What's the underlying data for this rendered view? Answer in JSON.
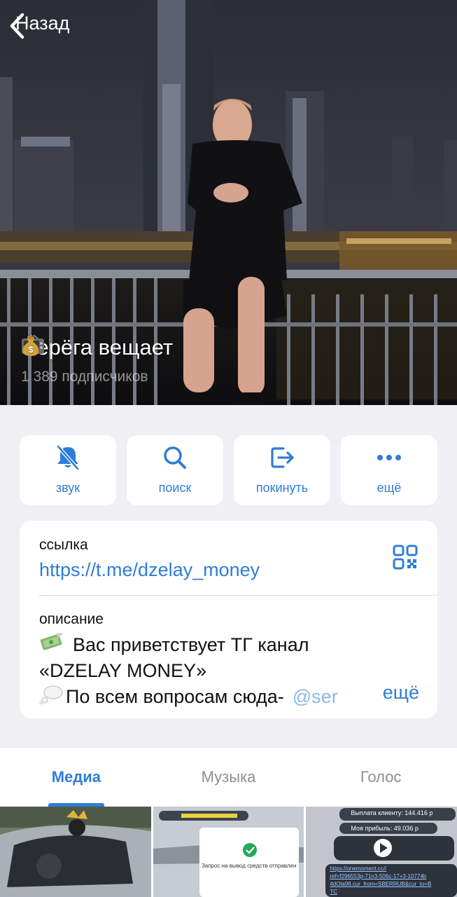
{
  "nav": {
    "back_label": "Назад"
  },
  "channel": {
    "title": "Серёга вещает",
    "subscribers": "1 389 подписчиков",
    "title_icons": [
      "tv-icon",
      "money-bag-icon"
    ]
  },
  "actions": [
    {
      "label": "звук",
      "icon": "bell-off-icon"
    },
    {
      "label": "поиск",
      "icon": "search-icon"
    },
    {
      "label": "покинуть",
      "icon": "leave-icon"
    },
    {
      "label": "ещё",
      "icon": "more-dots-icon"
    }
  ],
  "info": {
    "link_label": "ссылка",
    "link": "https://t.me/dzelay_money",
    "description_label": "описание",
    "description_lines": [
      "Вас приветствует ТГ канал",
      "«DZELAY MONEY»",
      "По всем вопросам сюда-"
    ],
    "mention": "@ser",
    "more_label": "ещё"
  },
  "tabs": [
    {
      "label": "Медиа",
      "active": true
    },
    {
      "label": "Музыка",
      "active": false
    },
    {
      "label": "Голос",
      "active": false
    }
  ],
  "media": {
    "item2_caption": "Запрос на вывод средств отправлен",
    "item3_payout": "Выплата клиенту: 144.416 р",
    "item3_profit": "Моя прибыль: 49.036 р",
    "item3_link": "https://onemoment.cc//",
    "item3_ref": "ref=f296553p-71n3-506c-17+3-10774b",
    "item3_ref2": "4dOla98.cur_from=SBERRUB&cur_to=B",
    "item3_ref3": "TC"
  },
  "colors": {
    "accent": "#2f7dd7",
    "background": "#efeff4"
  }
}
